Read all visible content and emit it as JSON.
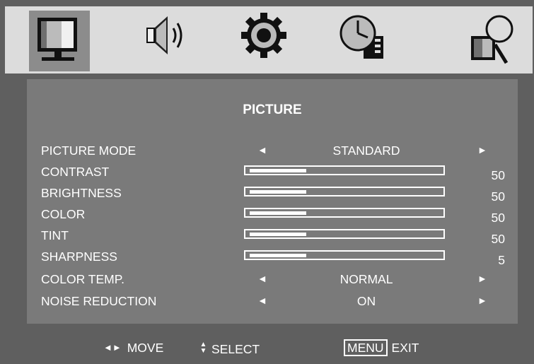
{
  "tabs": [
    {
      "icon": "tv-picture-icon",
      "active": true
    },
    {
      "icon": "speaker-sound-icon",
      "active": false
    },
    {
      "icon": "gear-setup-icon",
      "active": false
    },
    {
      "icon": "clock-time-icon",
      "active": false
    },
    {
      "icon": "magnifier-option-icon",
      "active": false
    }
  ],
  "menu": {
    "title": "PICTURE",
    "items": [
      {
        "label": "PICTURE MODE",
        "type": "select",
        "value": "STANDARD"
      },
      {
        "label": "CONTRAST",
        "type": "slider",
        "value": "50",
        "level": 0.3
      },
      {
        "label": "BRIGHTNESS",
        "type": "slider",
        "value": "50",
        "level": 0.3
      },
      {
        "label": "COLOR",
        "type": "slider",
        "value": "50",
        "level": 0.3
      },
      {
        "label": "TINT",
        "type": "slider",
        "value": "50",
        "level": 0.3
      },
      {
        "label": "SHARPNESS",
        "type": "slider",
        "value": "5",
        "level": 0.3
      },
      {
        "label": "COLOR TEMP.",
        "type": "select",
        "value": "NORMAL"
      },
      {
        "label": "NOISE REDUCTION",
        "type": "select",
        "value": "ON"
      }
    ],
    "arrow_left": "◄",
    "arrow_right": "►"
  },
  "footer": {
    "move_glyph": "◄►",
    "move_label": "MOVE",
    "select_glyph": "▲▼",
    "select_label": "SELECT",
    "menu_key": "MENU",
    "exit_label": "EXIT"
  },
  "colors": {
    "background": "#5f5f5f",
    "tab_bar": "#dcdcdc",
    "active_tab": "#8c8c8c",
    "panel": "#7a7a7a",
    "text": "#ffffff"
  }
}
